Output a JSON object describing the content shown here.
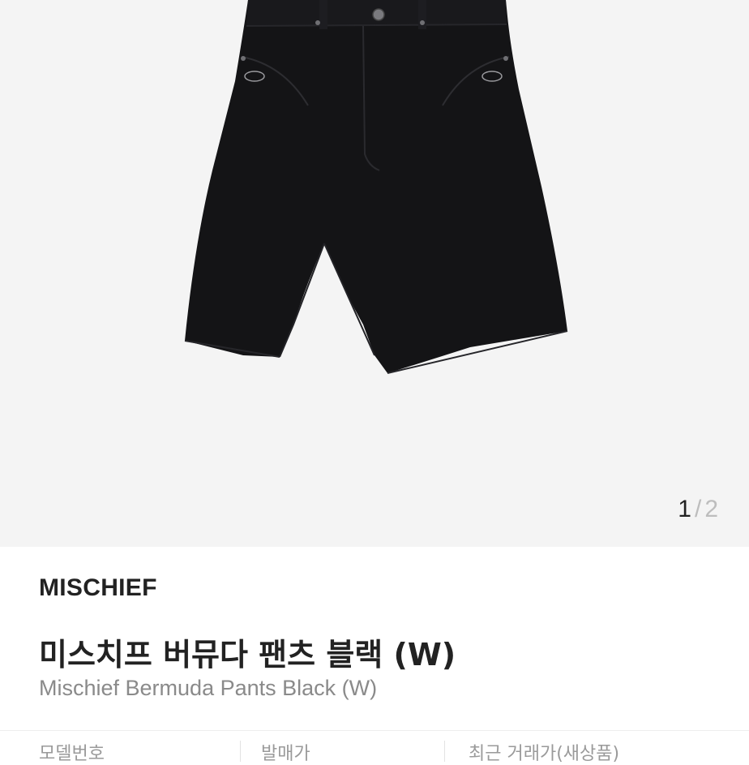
{
  "gallery": {
    "image": "black-bermuda-shorts",
    "current_page": "1",
    "separator": "/",
    "total_pages": "2"
  },
  "product": {
    "brand": "MISCHIEF",
    "name_ko": "미스치프 버뮤다 팬츠 블랙 (W)",
    "name_en": "Mischief Bermuda Pants Black (W)"
  },
  "details": {
    "model_label": "모델번호",
    "release_price_label": "발매가",
    "recent_price_label": "최근 거래가(새상품)"
  }
}
